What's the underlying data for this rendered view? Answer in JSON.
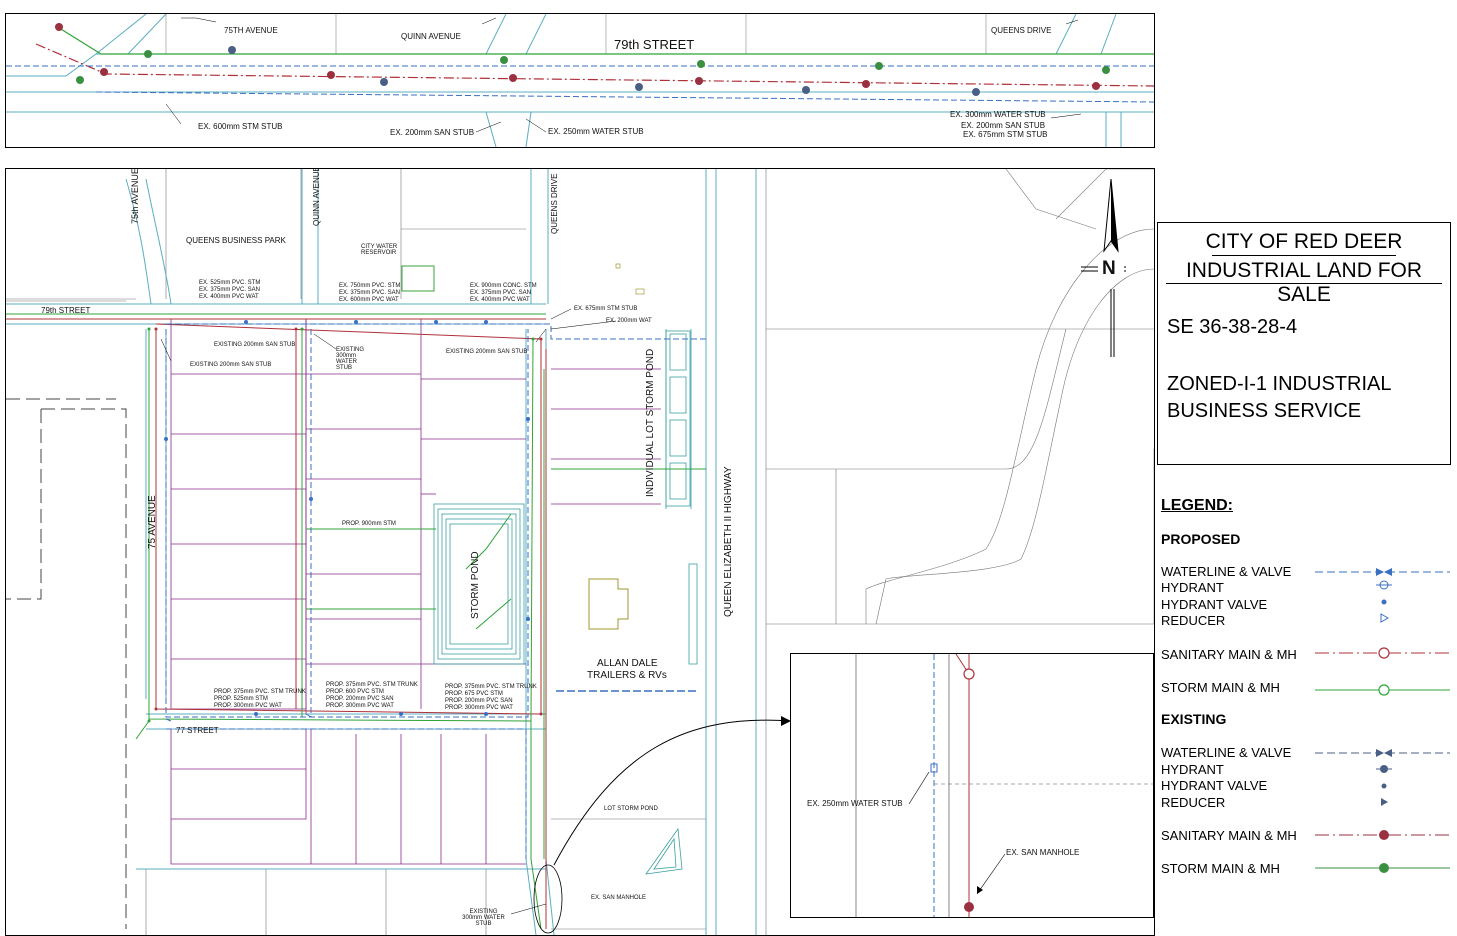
{
  "top_strip": {
    "streets": [
      "75TH AVENUE",
      "QUINN AVENUE",
      "79th STREET",
      "QUEENS DRIVE"
    ],
    "stubs": [
      "EX. 600mm STM STUB",
      "EX. 200mm SAN STUB",
      "EX. 250mm WATER STUB",
      "EX. 300mm WATER STUB",
      "EX. 200mm SAN STUB",
      "EX. 675mm STM STUB"
    ]
  },
  "main_plan": {
    "labels": {
      "street_79": "79th STREET",
      "ave_75_top": "75th AVENUE",
      "queens_business_park": "QUEENS BUSINESS PARK",
      "quinn_avenue": "QUINN AVENUE",
      "queens_drive": "QUEENS DRIVE",
      "city_water_reservoir": "CITY WATER RESERVOIR",
      "ave_75": "75 AVENUE",
      "street_77": "77 STREET",
      "storm_pond": "STORM POND",
      "individual_lot_storm_pond": "INDIVIDUAL LOT STORM POND",
      "qe2": "QUEEN ELIZABETH II HIGHWAY",
      "allan_dale_1": "ALLAN DALE",
      "allan_dale_2": "TRAILERS & RVs",
      "lot_storm_pond": "LOT STORM POND",
      "ex_san_manhole_small": "EX. SAN MANHOLE",
      "existing_water_stub_small": "EXISTING 300mm WATER STUB",
      "prop_900_stm": "PROP. 900mm STM",
      "ex_200_wat": "EX. 200mm WAT",
      "ex_675_stm_stub": "EX. 675mm STM STUB",
      "existing_200_san_stub_1": "EXISTING 200mm SAN STUB",
      "existing_200_san_stub_2": "EXISTING 200mm SAN STUB",
      "existing_200_san_stub_3": "EXISTING 200mm SAN STUB",
      "existing_300_water_stub": "EXISTING 300mm WATER STUB"
    },
    "notes": {
      "n1": [
        "EX. 525mm PVC. STM",
        "EX. 375mm PVC. SAN",
        "EX. 400mm PVC WAT"
      ],
      "n2": [
        "EX. 750mm PVC. STM",
        "EX. 375mm PVC. SAN",
        "EX. 600mm PVC WAT"
      ],
      "n3": [
        "EX. 900mm CONC. STM",
        "EX. 375mm PVC. SAN",
        "EX. 400mm PVC WAT"
      ],
      "n4": [
        "PROP. 375mm PVC. STM TRUNK",
        "PROP. 525mm STM",
        "PROP. 300mm PVC WAT"
      ],
      "n5": [
        "PROP. 375mm PVC. STM TRUNK",
        "PROP. 600 PVC STM",
        "PROP. 200mm PVC SAN",
        "PROP. 300mm PVC WAT"
      ],
      "n6": [
        "PROP. 375mm PVC. STM TRUNK",
        "PROP. 675 PVC STM",
        "PROP. 200mm PVC SAN",
        "PROP. 300mm PVC WAT"
      ]
    }
  },
  "inset": {
    "water_stub": "EX. 250mm WATER STUB",
    "san_manhole": "EX. SAN MANHOLE"
  },
  "title_block": {
    "line1": "CITY OF RED DEER",
    "line2": "INDUSTRIAL LAND FOR SALE",
    "legal": "SE 36-38-28-4",
    "zoning1": "ZONED-I-1 INDUSTRIAL",
    "zoning2": "BUSINESS SERVICE"
  },
  "north_arrow": {
    "label": "N"
  },
  "legend": {
    "title": "LEGEND:",
    "proposed_heading": "PROPOSED",
    "proposed": [
      "WATERLINE & VALVE",
      "HYDRANT",
      "HYDRANT VALVE",
      "REDUCER",
      "SANITARY MAIN & MH",
      "STORM MAIN & MH"
    ],
    "existing_heading": "EXISTING",
    "existing": [
      "WATERLINE & VALVE",
      "HYDRANT",
      "HYDRANT VALVE",
      "REDUCER",
      "SANITARY MAIN & MH",
      "STORM MAIN & MH"
    ]
  },
  "colors": {
    "water": "#3a6fc4",
    "sanitary": "#b0303a",
    "storm": "#2fa33a",
    "parcel": "#8a2a8a",
    "road": "#5aaec0",
    "sanitary_mh": "#9a3040",
    "storm_mh": "#3a9040",
    "water_existing": "#4a5f85"
  }
}
